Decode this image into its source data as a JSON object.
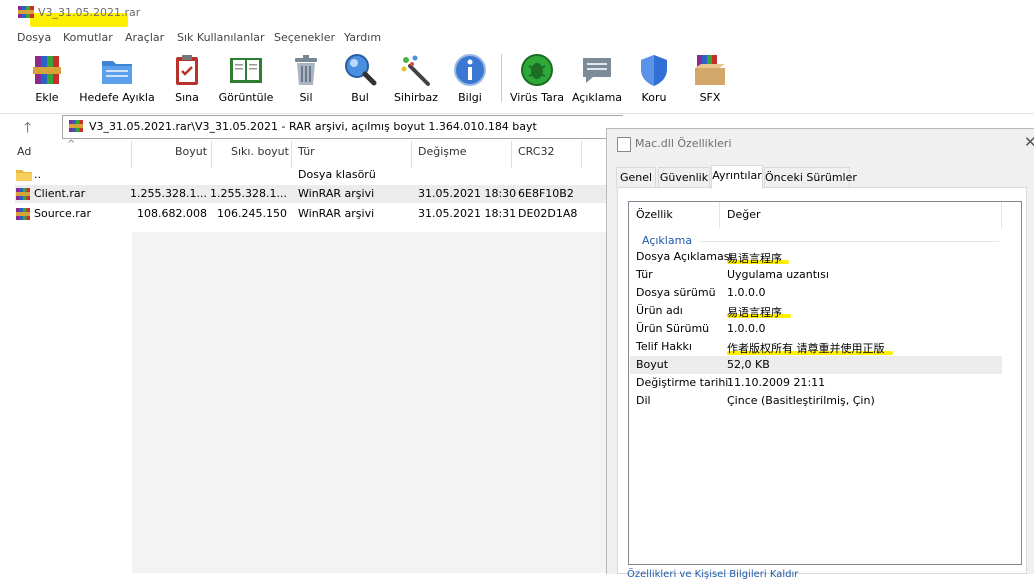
{
  "window": {
    "title": "V3_31.05.2021.rar"
  },
  "menu": [
    "Dosya",
    "Komutlar",
    "Araçlar",
    "Sık Kullanılanlar",
    "Seçenekler",
    "Yardım"
  ],
  "toolbar": [
    {
      "label": "Ekle",
      "icon": "archive-add-icon"
    },
    {
      "label": "Hedefe Ayıkla",
      "icon": "extract-folder-icon"
    },
    {
      "label": "Sına",
      "icon": "test-clipboard-icon"
    },
    {
      "label": "Görüntüle",
      "icon": "view-book-icon"
    },
    {
      "label": "Sil",
      "icon": "trash-icon"
    },
    {
      "label": "Bul",
      "icon": "find-magnifier-icon"
    },
    {
      "label": "Sihirbaz",
      "icon": "wizard-wand-icon"
    },
    {
      "label": "Bilgi",
      "icon": "info-icon"
    },
    {
      "label": "Virüs Tara",
      "icon": "virus-scan-icon"
    },
    {
      "label": "Açıklama",
      "icon": "comment-icon"
    },
    {
      "label": "Koru",
      "icon": "protect-shield-icon"
    },
    {
      "label": "SFX",
      "icon": "sfx-box-icon"
    }
  ],
  "address": {
    "path": "V3_31.05.2021.rar\\V3_31.05.2021 - RAR arşivi, açılmış boyut 1.364.010.184 bayt"
  },
  "filelist": {
    "columns": [
      "Ad",
      "Boyut",
      "Sıkı. boyut",
      "Tür",
      "Değişme",
      "CRC32"
    ],
    "rows": [
      {
        "name": "..",
        "size": "",
        "packed": "",
        "type": "Dosya klasörü",
        "modified": "",
        "crc": ""
      },
      {
        "name": "Client.rar",
        "size": "1.255.328.1...",
        "packed": "1.255.328.1...",
        "type": "WinRAR arşivi",
        "modified": "31.05.2021 18:30",
        "crc": "6E8F10B2"
      },
      {
        "name": "Source.rar",
        "size": "108.682.008",
        "packed": "106.245.150",
        "type": "WinRAR arşivi",
        "modified": "31.05.2021 18:31",
        "crc": "DE02D1A8"
      }
    ]
  },
  "dialog": {
    "title": "Mac.dll Özellikleri",
    "tabs": [
      "Genel",
      "Güvenlik",
      "Ayrıntılar",
      "Önceki Sürümler"
    ],
    "active_tab": "Ayrıntılar",
    "headers": [
      "Özellik",
      "Değer"
    ],
    "group": "Açıklama",
    "properties": [
      {
        "key": "Dosya Açıklaması",
        "value": "易语言程序"
      },
      {
        "key": "Tür",
        "value": "Uygulama uzantısı"
      },
      {
        "key": "Dosya sürümü",
        "value": "1.0.0.0"
      },
      {
        "key": "Ürün adı",
        "value": "易语言程序"
      },
      {
        "key": "Ürün Sürümü",
        "value": "1.0.0.0"
      },
      {
        "key": "Telif Hakkı",
        "value": "作者版权所有 请尊重并使用正版"
      },
      {
        "key": "Boyut",
        "value": "52,0 KB"
      },
      {
        "key": "Değiştirme tarihi",
        "value": "11.10.2009 21:11"
      },
      {
        "key": "Dil",
        "value": "Çince (Basitleştirilmiş, Çin)"
      }
    ],
    "link": "Özellikleri ve Kişisel Bilgileri Kaldır"
  },
  "colors": {
    "highlight": "#ffef00",
    "link": "#1e5aa8",
    "selection": "#ececec"
  }
}
